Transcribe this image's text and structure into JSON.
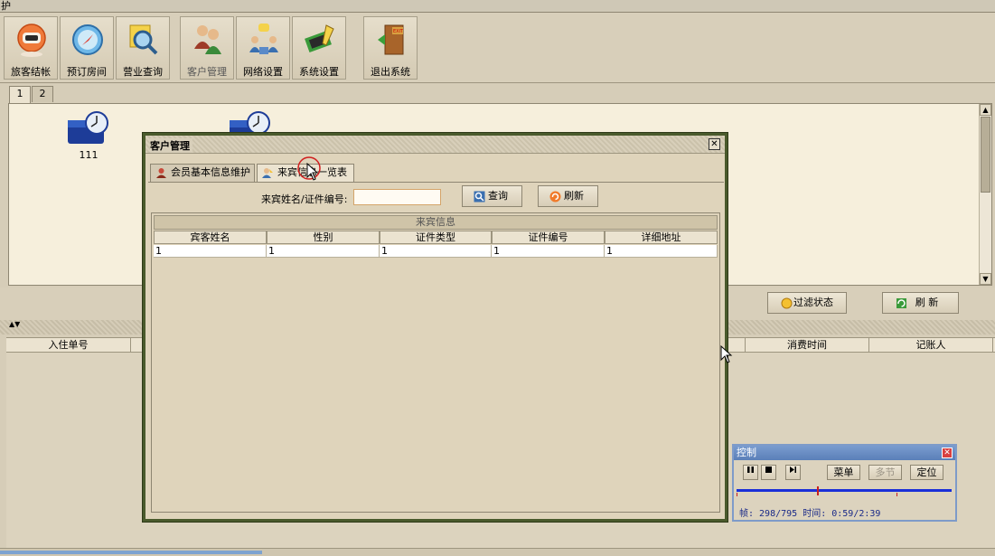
{
  "window": {
    "title_fragment": "护"
  },
  "toolbar": {
    "buttons": [
      {
        "label": "旅客结帐",
        "icon": "robot-icon"
      },
      {
        "label": "预订房间",
        "icon": "compass-icon"
      },
      {
        "label": "营业查询",
        "icon": "search-icon"
      },
      {
        "label": "客户管理",
        "icon": "customer-icon"
      },
      {
        "label": "网络设置",
        "icon": "network-icon"
      },
      {
        "label": "系统设置",
        "icon": "tools-icon"
      },
      {
        "label": "退出系统",
        "icon": "exit-door-icon"
      }
    ]
  },
  "floor_tabs": [
    "1",
    "2"
  ],
  "rooms": [
    {
      "label": "111"
    },
    {
      "label": ""
    }
  ],
  "mid_actions": {
    "filter_label": "过滤状态",
    "refresh_label": "刷  新"
  },
  "bottom_table": {
    "headers": [
      "入住单号",
      "消费时间",
      "记账人"
    ]
  },
  "dialog": {
    "title": "客户管理",
    "tabs": [
      {
        "label": "会员基本信息维护",
        "icon": "member-icon"
      },
      {
        "label": "来宾信息一览表",
        "icon": "guest-icon"
      }
    ],
    "active_tab": 1,
    "search": {
      "label": "来宾姓名/证件编号:",
      "value": "",
      "placeholder": ""
    },
    "query_label": "查询",
    "refresh_label": "刷新",
    "grid": {
      "caption": "来宾信息",
      "headers": [
        "宾客姓名",
        "性别",
        "证件类型",
        "证件编号",
        "详细地址"
      ],
      "rows": [
        [
          "1",
          "1",
          "1",
          "1",
          "1"
        ]
      ]
    }
  },
  "control_panel": {
    "title": "控制",
    "menu_label": "菜单",
    "multi_label": "多节",
    "locate_label": "定位",
    "status": "帧: 298/795 时间: 0:59/2:39",
    "progress_fraction": 0.375
  },
  "colors": {
    "dialog_border": "#4a5a2c",
    "control_title": "#5a7fb8",
    "progress_track": "#1a2fd8",
    "search_border": "#d4a46a"
  }
}
